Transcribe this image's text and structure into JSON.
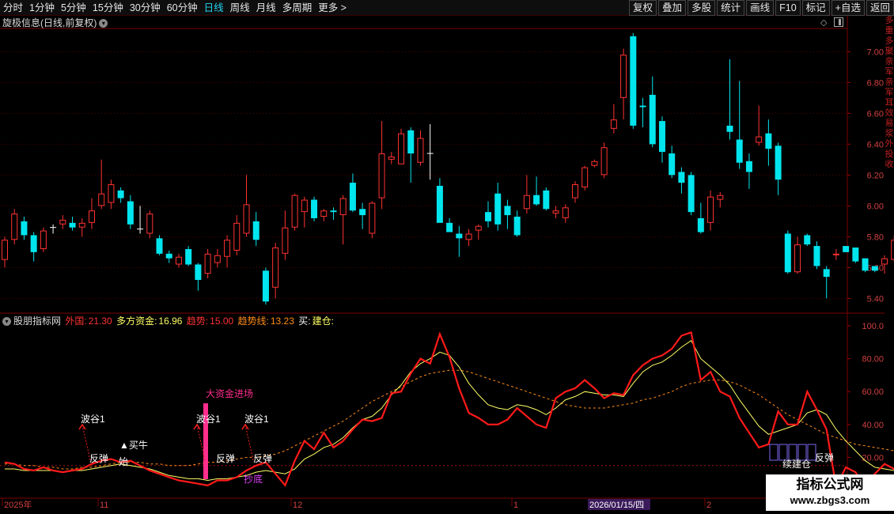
{
  "toolbar": {
    "periods": [
      "分时",
      "1分钟",
      "5分钟",
      "15分钟",
      "30分钟",
      "60分钟",
      "日线",
      "周线",
      "月线",
      "多周期",
      "更多 >"
    ],
    "active_period": "日线",
    "buttons": [
      "复权",
      "叠加",
      "多股",
      "统计",
      "画线",
      "F10",
      "标记",
      "+自选",
      "返回"
    ]
  },
  "main_chart": {
    "title": "旋极信息(日线,前复权)",
    "price_axis": [
      "7.00",
      "6.80",
      "6.60",
      "6.40",
      "6.20",
      "6.00",
      "5.80",
      "5.60",
      "5.40"
    ],
    "price_range": [
      5.32,
      7.14
    ],
    "candles": [
      [
        5.65,
        5.78,
        5.6,
        5.8
      ],
      [
        5.78,
        5.95,
        5.75,
        5.98
      ],
      [
        5.9,
        5.81,
        5.78,
        5.93
      ],
      [
        5.81,
        5.7,
        5.64,
        5.83
      ],
      [
        5.72,
        5.84,
        5.7,
        5.86
      ],
      [
        5.86,
        5.86,
        5.82,
        5.88
      ],
      [
        5.88,
        5.91,
        5.85,
        5.94
      ],
      [
        5.89,
        5.86,
        5.84,
        5.93
      ],
      [
        5.86,
        5.89,
        5.8,
        5.92
      ],
      [
        5.89,
        5.97,
        5.85,
        6.05
      ],
      [
        6.0,
        6.08,
        5.98,
        6.3
      ],
      [
        6.02,
        6.14,
        5.98,
        6.17
      ],
      [
        6.1,
        6.05,
        6.02,
        6.12
      ],
      [
        6.03,
        5.88,
        5.85,
        6.07
      ],
      [
        5.85,
        5.85,
        5.82,
        6.0
      ],
      [
        5.82,
        5.95,
        5.79,
        5.97
      ],
      [
        5.79,
        5.69,
        5.68,
        5.81
      ],
      [
        5.69,
        5.66,
        5.63,
        5.71
      ],
      [
        5.62,
        5.67,
        5.6,
        5.69
      ],
      [
        5.72,
        5.62,
        5.61,
        5.74
      ],
      [
        5.62,
        5.52,
        5.45,
        5.63
      ],
      [
        5.56,
        5.69,
        5.53,
        5.72
      ],
      [
        5.63,
        5.68,
        5.6,
        5.72
      ],
      [
        5.67,
        5.78,
        5.6,
        5.81
      ],
      [
        5.71,
        5.89,
        5.68,
        5.94
      ],
      [
        5.82,
        6.01,
        5.8,
        6.2
      ],
      [
        5.9,
        5.78,
        5.74,
        5.96
      ],
      [
        5.58,
        5.38,
        5.36,
        5.6
      ],
      [
        5.47,
        5.73,
        5.4,
        5.76
      ],
      [
        5.69,
        5.86,
        5.65,
        5.97
      ],
      [
        5.86,
        6.07,
        5.84,
        6.08
      ],
      [
        5.96,
        6.04,
        5.86,
        6.06
      ],
      [
        6.04,
        5.92,
        5.9,
        6.06
      ],
      [
        5.93,
        5.97,
        5.9,
        5.98
      ],
      [
        5.97,
        5.96,
        5.91,
        5.99
      ],
      [
        5.94,
        6.05,
        5.75,
        6.07
      ],
      [
        6.15,
        5.97,
        5.96,
        6.21
      ],
      [
        5.98,
        5.94,
        5.85,
        6.02
      ],
      [
        5.82,
        6.02,
        5.79,
        6.03
      ],
      [
        6.05,
        6.34,
        5.98,
        6.55
      ],
      [
        6.3,
        6.32,
        6.27,
        6.35
      ],
      [
        6.27,
        6.47,
        6.27,
        6.5
      ],
      [
        6.49,
        6.34,
        6.15,
        6.51
      ],
      [
        6.28,
        6.44,
        6.26,
        6.49
      ],
      [
        6.34,
        6.34,
        6.17,
        6.53
      ],
      [
        6.13,
        5.89,
        5.89,
        6.18
      ],
      [
        5.89,
        5.83,
        5.85,
        5.92
      ],
      [
        5.82,
        5.79,
        5.67,
        5.87
      ],
      [
        5.78,
        5.82,
        5.74,
        5.85
      ],
      [
        5.84,
        5.87,
        5.78,
        5.88
      ],
      [
        5.96,
        5.9,
        5.86,
        6.03
      ],
      [
        6.08,
        5.88,
        5.84,
        6.15
      ],
      [
        6.0,
        5.94,
        5.85,
        6.04
      ],
      [
        5.93,
        5.81,
        5.8,
        5.97
      ],
      [
        5.98,
        6.07,
        5.95,
        6.2
      ],
      [
        6.07,
        6.01,
        6.0,
        6.19
      ],
      [
        6.1,
        5.98,
        5.97,
        6.12
      ],
      [
        5.95,
        5.97,
        5.92,
        6.0
      ],
      [
        5.92,
        5.99,
        5.89,
        6.01
      ],
      [
        6.05,
        6.14,
        6.02,
        6.16
      ],
      [
        6.12,
        6.25,
        6.1,
        6.26
      ],
      [
        6.26,
        6.29,
        6.25,
        6.3
      ],
      [
        6.2,
        6.38,
        6.18,
        6.41
      ],
      [
        6.5,
        6.56,
        6.47,
        6.66
      ],
      [
        6.7,
        6.98,
        6.56,
        7.02
      ],
      [
        7.1,
        6.52,
        6.5,
        7.12
      ],
      [
        6.65,
        6.64,
        6.51,
        6.7
      ],
      [
        6.72,
        6.4,
        6.38,
        6.84
      ],
      [
        6.55,
        6.35,
        6.28,
        6.58
      ],
      [
        6.34,
        6.2,
        6.18,
        6.39
      ],
      [
        6.22,
        6.15,
        6.08,
        6.25
      ],
      [
        6.2,
        5.96,
        5.94,
        6.22
      ],
      [
        5.92,
        5.83,
        5.82,
        6.02
      ],
      [
        5.89,
        6.06,
        5.84,
        6.1
      ],
      [
        6.04,
        6.07,
        5.99,
        6.09
      ],
      [
        6.52,
        6.48,
        6.43,
        6.95
      ],
      [
        6.43,
        6.28,
        6.24,
        6.81
      ],
      [
        6.29,
        6.22,
        6.11,
        6.34
      ],
      [
        6.41,
        6.45,
        6.39,
        6.65
      ],
      [
        6.47,
        6.37,
        6.26,
        6.56
      ],
      [
        6.39,
        6.17,
        6.07,
        6.41
      ],
      [
        5.82,
        5.57,
        5.56,
        5.84
      ],
      [
        5.57,
        5.75,
        5.56,
        5.8
      ],
      [
        5.81,
        5.75,
        5.74,
        5.82
      ],
      [
        5.74,
        5.61,
        5.59,
        5.77
      ],
      [
        5.59,
        5.54,
        5.4,
        5.61
      ],
      [
        5.68,
        5.69,
        5.65,
        5.72
      ],
      [
        5.74,
        5.7,
        5.7,
        5.74
      ],
      [
        5.73,
        5.64,
        5.63,
        5.73
      ],
      [
        5.66,
        5.58,
        5.57,
        5.66
      ],
      [
        5.61,
        5.58,
        5.57,
        5.6
      ],
      [
        5.62,
        5.66,
        5.56,
        5.68
      ],
      [
        5.65,
        5.78,
        5.64,
        5.81
      ]
    ]
  },
  "indicator": {
    "title": "股朋指标网",
    "waigong": {
      "label": "外国:",
      "value": "21.30"
    },
    "duofang": {
      "label": "多方资金:",
      "value": "16.96"
    },
    "qushi": {
      "label": "趋势:",
      "value": "15.00"
    },
    "qushixian": {
      "label": "趋势线:",
      "value": "13.23"
    },
    "buy": {
      "label": "买:",
      "value": "建仓:"
    },
    "axis": [
      "100.0",
      "80.00",
      "60.00",
      "40.00",
      "20.00"
    ],
    "red_line": [
      17,
      16,
      13,
      12,
      14,
      12,
      11,
      12,
      13,
      16,
      18,
      19,
      17,
      18,
      15,
      12,
      10,
      8,
      6,
      5,
      4,
      3,
      6,
      6,
      8,
      12,
      15,
      17,
      10,
      3,
      18,
      30,
      25,
      35,
      26,
      30,
      37,
      43,
      42,
      44,
      59,
      60,
      71,
      80,
      77,
      95,
      81,
      62,
      47,
      44,
      40,
      40,
      43,
      50,
      45,
      40,
      38,
      56,
      60,
      62,
      67,
      62,
      56,
      59,
      58,
      70,
      76,
      80,
      82,
      86,
      94,
      96,
      67,
      72,
      60,
      57,
      44,
      35,
      26,
      28,
      48,
      40,
      40,
      60,
      49,
      37,
      2,
      14,
      11,
      1,
      10,
      16,
      13,
      7,
      3,
      3,
      5,
      14,
      21
    ],
    "yellow_line": [
      13,
      13,
      12,
      12,
      12,
      12,
      11,
      12,
      12,
      13,
      14,
      15,
      16,
      15,
      14,
      13,
      11,
      9,
      8,
      7,
      7,
      6,
      7,
      7,
      8,
      9,
      11,
      12,
      11,
      10,
      13,
      19,
      22,
      26,
      28,
      32,
      38,
      43,
      45,
      50,
      58,
      64,
      72,
      77,
      80,
      84,
      82,
      75,
      65,
      58,
      52,
      50,
      49,
      52,
      51,
      49,
      46,
      50,
      55,
      57,
      60,
      59,
      58,
      58,
      57,
      65,
      72,
      76,
      78,
      82,
      87,
      91,
      80,
      75,
      70,
      64,
      55,
      47,
      39,
      34,
      36,
      38,
      40,
      47,
      49,
      46,
      37,
      30,
      24,
      18,
      14,
      13,
      12,
      11,
      9,
      10,
      12,
      14,
      18
    ],
    "orange_dashed": [
      16,
      16,
      15,
      15,
      14,
      14,
      13,
      13,
      14,
      14,
      15,
      16,
      17,
      17,
      17,
      16,
      16,
      15,
      15,
      15,
      16,
      17,
      17,
      18,
      19,
      20,
      20,
      21,
      22,
      24,
      27,
      30,
      33,
      36,
      39,
      42,
      46,
      50,
      54,
      57,
      60,
      63,
      66,
      69,
      71,
      72,
      73,
      73,
      72,
      70,
      68,
      66,
      64,
      62,
      60,
      58,
      56,
      54,
      52,
      51,
      50,
      50,
      50,
      51,
      52,
      53,
      55,
      56,
      58,
      60,
      63,
      65,
      66,
      67,
      67,
      66,
      64,
      61,
      58,
      54,
      50,
      46,
      43,
      40,
      37,
      34,
      32,
      30,
      28,
      27,
      26,
      25,
      24,
      23,
      22,
      21,
      21,
      21,
      21
    ],
    "annotations": {
      "bogu1": "波谷1",
      "fantan": "反弹",
      "buy_cattle": "▲买牛",
      "shi": "始",
      "big_money": "大资金进场",
      "chaodi": "抄底",
      "jiancang": "建仓",
      "jiancang_partial": "续",
      "fantan_right": "反弹"
    }
  },
  "time_axis": {
    "labels": [
      "2025年",
      "11",
      "12",
      "1",
      "2"
    ],
    "cursor_date": "2026/01/15/四"
  },
  "watermark": {
    "title": "指标公式网",
    "url": "www.zbgs3.com"
  },
  "right_strip_text": "多重多聚亲军亲军耳效易浆外投收",
  "colors": {
    "up": "#ff3232",
    "down": "#00e5ee",
    "red_line": "#ff1a1a",
    "yellow_line": "#ffff66",
    "orange_dashed": "#ff8c1a",
    "annotation_pink": "#ff2d8c",
    "annotation_magenta": "#e040fb",
    "grid": "#5a0000"
  }
}
